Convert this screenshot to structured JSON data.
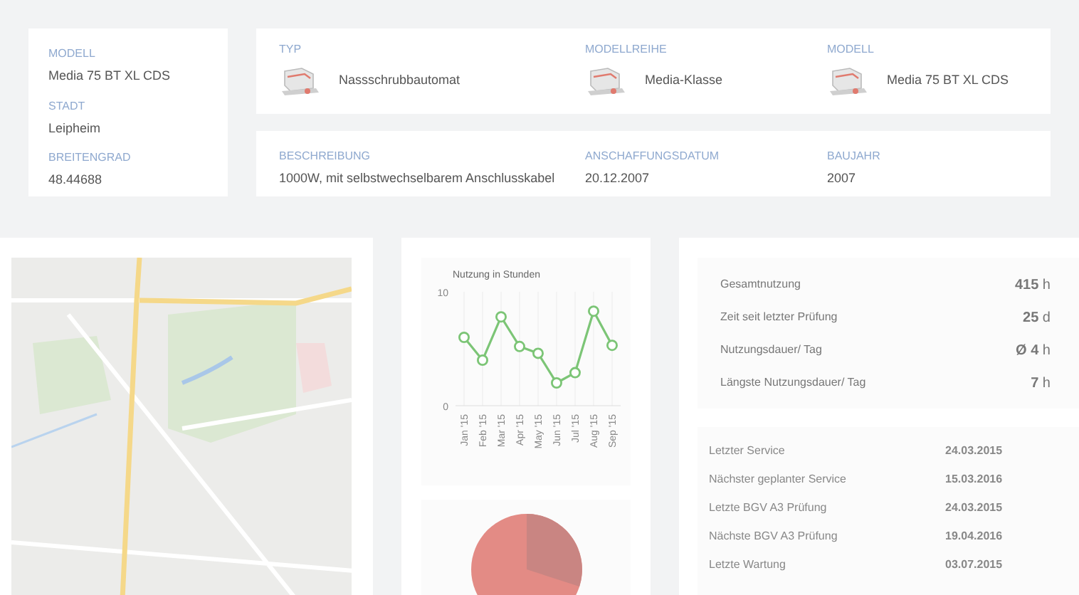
{
  "location": [
    {
      "label": "MODELL",
      "value": "Media 75 BT XL CDS"
    },
    {
      "label": "STADT",
      "value": "Leipheim"
    },
    {
      "label": "BREITENGRAD",
      "value": "48.44688"
    }
  ],
  "machine": [
    {
      "label": "TYP",
      "value": "Nassschrubbautomat"
    },
    {
      "label": "MODELLREIHE",
      "value": "Media-Klasse"
    },
    {
      "label": "MODELL",
      "value": "Media 75 BT XL CDS"
    }
  ],
  "details": [
    {
      "label": "BESCHREIBUNG",
      "value": "1000W, mit selbstwechselbarem Anschlusskabel"
    },
    {
      "label": "ANSCHAFFUNGSDATUM",
      "value": "20.12.2007"
    },
    {
      "label": "BAUJAHR",
      "value": "2007"
    }
  ],
  "usage_chart": {
    "chart_data": {
      "type": "line",
      "title": "Nutzung in Stunden",
      "grid": true,
      "categories": [
        "Jan '15",
        "Feb '15",
        "Mar '15",
        "Apr '15",
        "May '15",
        "Jun '15",
        "Jul '15",
        "Aug '15",
        "Sep '15"
      ],
      "series": [
        {
          "color": "#7cc576",
          "marker": "circle",
          "values": [
            6,
            4,
            7.8,
            5.2,
            4.6,
            2,
            2.9,
            8.3,
            5.3
          ]
        }
      ],
      "ylim": [
        0,
        10
      ],
      "yticks": [
        0,
        10
      ]
    }
  },
  "stats": [
    {
      "label": "Gesamtnutzung",
      "value": "**415** h"
    },
    {
      "label": "Zeit seit letzter Prüfung",
      "value": "**25** d"
    },
    {
      "label": "Nutzungsdauer/ Tag",
      "value": "**Ø 4** h"
    },
    {
      "label": "Längste Nutzungsdauer/ Tag",
      "value": "**7** h"
    }
  ],
  "service_dates": [
    {
      "label": "Letzter Service",
      "value": "24.03.2015"
    },
    {
      "label": "Nächster geplanter Service",
      "value": "15.03.2016"
    },
    {
      "label": "Letzte BGV A3 Prüfung",
      "value": "24.03.2015"
    },
    {
      "label": "Nächste BGV A3 Prüfung",
      "value": "19.04.2016"
    },
    {
      "label": "Letzte Wartung",
      "value": "03.07.2015"
    }
  ]
}
